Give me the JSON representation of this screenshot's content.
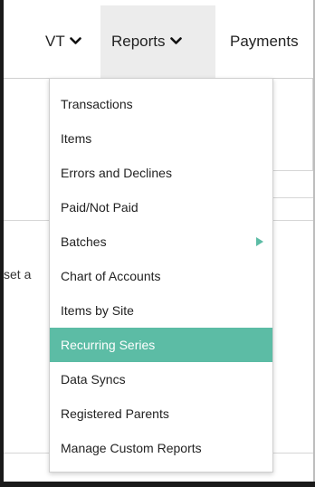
{
  "nav": {
    "vt_label": "VT",
    "reports_label": "Reports",
    "payments_label": "Payments"
  },
  "background": {
    "partial_text": "set a"
  },
  "menu": {
    "items": [
      {
        "label": "Transactions",
        "active": false,
        "has_submenu": false
      },
      {
        "label": "Items",
        "active": false,
        "has_submenu": false
      },
      {
        "label": "Errors and Declines",
        "active": false,
        "has_submenu": false
      },
      {
        "label": "Paid/Not Paid",
        "active": false,
        "has_submenu": false
      },
      {
        "label": "Batches",
        "active": false,
        "has_submenu": true
      },
      {
        "label": "Chart of Accounts",
        "active": false,
        "has_submenu": false
      },
      {
        "label": "Items by Site",
        "active": false,
        "has_submenu": false
      },
      {
        "label": "Recurring Series",
        "active": true,
        "has_submenu": false
      },
      {
        "label": "Data Syncs",
        "active": false,
        "has_submenu": false
      },
      {
        "label": "Registered Parents",
        "active": false,
        "has_submenu": false
      },
      {
        "label": "Manage Custom Reports",
        "active": false,
        "has_submenu": false
      }
    ]
  },
  "colors": {
    "accent": "#5cbca5",
    "nav_active_bg": "#ececec"
  },
  "icons": {
    "dropdown": "chevron-down-icon",
    "submenu": "caret-right-icon"
  }
}
